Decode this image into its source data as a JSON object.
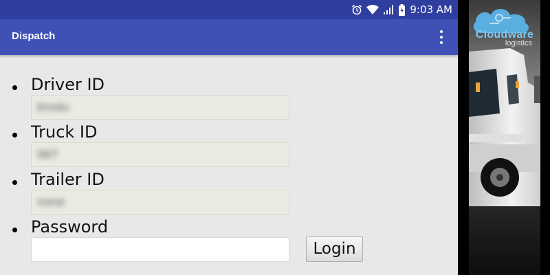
{
  "status_bar": {
    "time": "9:03 AM",
    "icons": [
      "alarm-icon",
      "wifi-icon",
      "signal-icon",
      "battery-charging-icon"
    ]
  },
  "app_bar": {
    "title": "Dispatch",
    "overflow_icon": "more-vert-icon"
  },
  "form": {
    "fields": [
      {
        "label": "Driver ID",
        "value": "brodu"
      },
      {
        "label": "Truck ID",
        "value": "067"
      },
      {
        "label": "Trailer ID",
        "value": "none"
      },
      {
        "label": "Password",
        "value": ""
      }
    ],
    "login_label": "Login"
  },
  "side_panel": {
    "logo_main": "Cloudware",
    "logo_sub": "logistics"
  },
  "colors": {
    "status_bar": "#303f9f",
    "app_bar": "#3f51b5",
    "background": "#e8e8e8",
    "logo_blue": "#7ec8ee"
  }
}
